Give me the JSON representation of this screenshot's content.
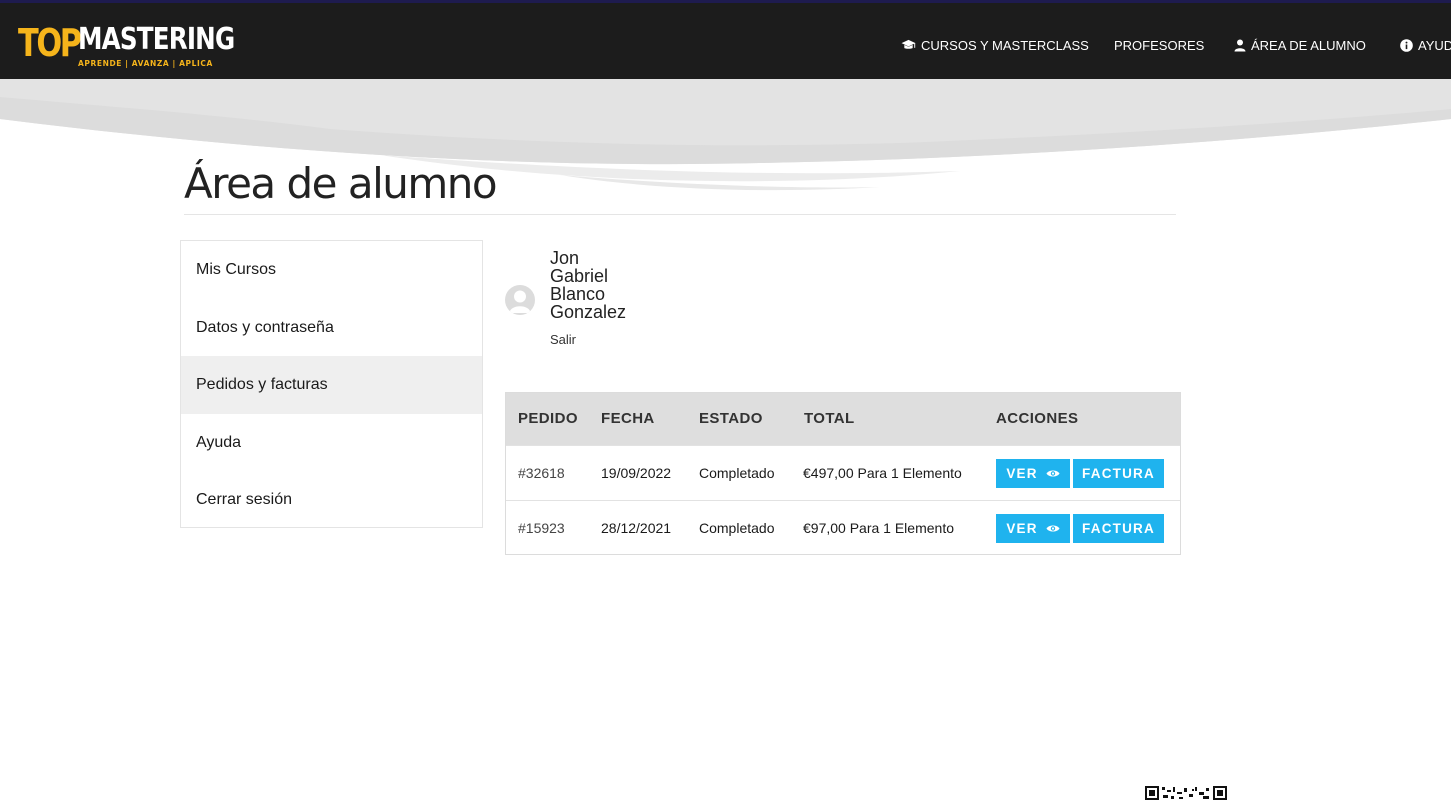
{
  "header": {
    "logo": {
      "top": "TOP",
      "main": "MASTERING",
      "tagline": "APRENDE | AVANZA | APLICA"
    },
    "nav": [
      {
        "label": "CURSOS Y MASTERCLASS",
        "icon": "graduation-cap-icon"
      },
      {
        "label": "PROFESORES"
      },
      {
        "label": "ÁREA DE ALUMNO",
        "icon": "user-icon"
      },
      {
        "label": "AYUD",
        "icon": "info-icon"
      }
    ]
  },
  "page": {
    "title": "Área de alumno"
  },
  "sidebar": {
    "items": [
      {
        "label": "Mis Cursos"
      },
      {
        "label": "Datos y contraseña"
      },
      {
        "label": "Pedidos y facturas",
        "active": true
      },
      {
        "label": "Ayuda"
      },
      {
        "label": "Cerrar sesión"
      }
    ]
  },
  "user": {
    "name_lines": [
      "Jon",
      "Gabriel",
      "Blanco",
      "Gonzalez"
    ],
    "logout_label": "Salir"
  },
  "orders": {
    "headers": [
      "PEDIDO",
      "FECHA",
      "ESTADO",
      "TOTAL",
      "ACCIONES"
    ],
    "rows": [
      {
        "order": "#32618",
        "date": "19/09/2022",
        "status": "Completado",
        "total": "€497,00 Para 1 Elemento",
        "view_label": "VER",
        "invoice_label": "FACTURA"
      },
      {
        "order": "#15923",
        "date": "28/12/2021",
        "status": "Completado",
        "total": "€97,00 Para 1 Elemento",
        "view_label": "VER",
        "invoice_label": "FACTURA"
      }
    ]
  },
  "colors": {
    "header_bg": "#1c1c1c",
    "brand_yellow": "#f5b41b",
    "button_blue": "#1fb3ee",
    "table_head_bg": "#dedede",
    "active_item_bg": "#efefef"
  }
}
